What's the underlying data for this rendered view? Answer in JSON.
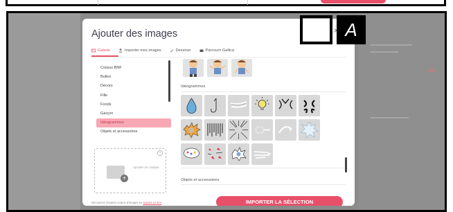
{
  "modal": {
    "title": "Ajouter des images",
    "close_label": "×",
    "tabs": [
      {
        "label": "Galerie",
        "icon": "gallery-icon"
      },
      {
        "label": "Importer mes images",
        "icon": "upload-icon"
      },
      {
        "label": "Dessiner",
        "icon": "pencil-icon"
      },
      {
        "label": "Parcourir Gallica",
        "icon": "folder-icon"
      }
    ]
  },
  "sidebar": {
    "items": [
      {
        "label": "Corpus BNF"
      },
      {
        "label": "Bulles"
      },
      {
        "label": "Décors"
      },
      {
        "label": "Fille"
      },
      {
        "label": "Fonds"
      },
      {
        "label": "Garçon"
      },
      {
        "label": "Idéogrammes"
      },
      {
        "label": "Objets et accessoires"
      }
    ],
    "add_corpus_label": "Ajouter un corpus",
    "info_icon": "i"
  },
  "content": {
    "section_heading": "Idéogrammes",
    "next_heading": "Objets et accessoires"
  },
  "footer": {
    "text_before": "Découvrez d'autres corpus d'images en ",
    "link_text": "suivant ce lien",
    "import_button": "IMPORTER LA SÉLECTION"
  },
  "annotation": {
    "badge_label": "A"
  },
  "colors": {
    "accent": "#e8506a",
    "active_bg": "#f7a8b4"
  }
}
